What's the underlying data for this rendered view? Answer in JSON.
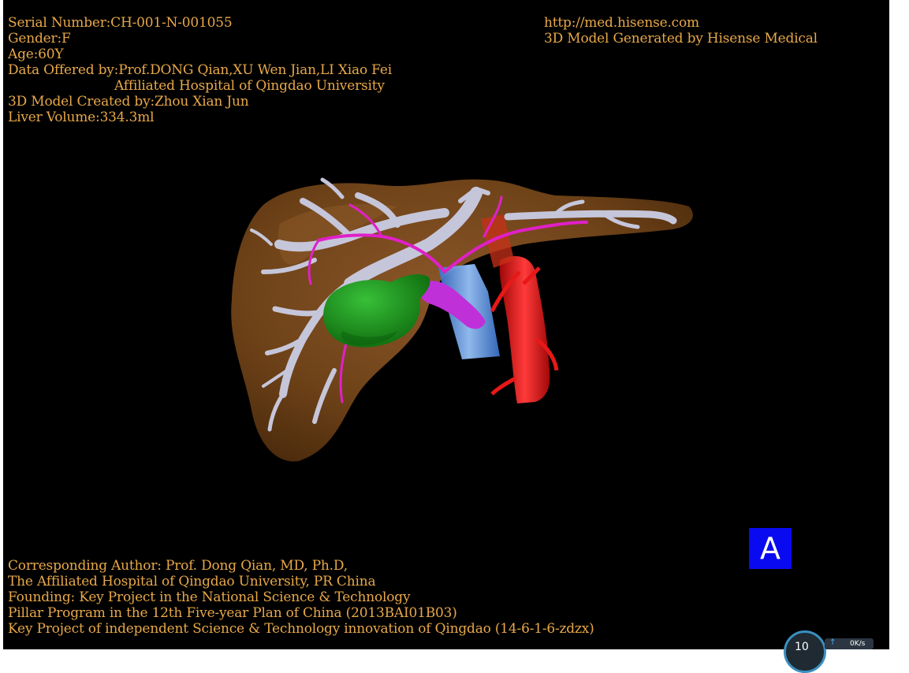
{
  "header_left": {
    "serial": "Serial Number:CH-001-N-001055",
    "gender": "Gender:F",
    "age": "Age:60Y",
    "data_offered": "Data Offered by:Prof.DONG Qian,XU Wen Jian,LI Xiao Fei",
    "hospital": "Affiliated Hospital of Qingdao University",
    "model_created": "3D Model Created by:Zhou Xian Jun",
    "liver_volume": "Liver Volume:334.3ml"
  },
  "header_right": {
    "url": "http://med.hisense.com",
    "generated_by": "3D Model Generated by Hisense Medical"
  },
  "footer": {
    "line1": "Corresponding Author: Prof. Dong Qian, MD, Ph.D,",
    "line2": "The Affiliated Hospital of Qingdao University, PR China",
    "line3": "Founding: Key Project in the National Science & Technology",
    "line4": "Pillar Program in the 12th Five-year Plan of China (2013BAI01B03)",
    "line5": "Key Project of independent Science & Technology innovation of Qingdao (14-6-1-6-zdzx)"
  },
  "view_label": "A",
  "net_widget": {
    "number": "10",
    "speed": "0K/s"
  },
  "colors": {
    "text": "#e8a848",
    "liver": "#7a4a1c",
    "portal_vein": "#c8c8dc",
    "hepatic_artery": "#e020c8",
    "tumor": "#1e9a1e",
    "ivc": "#6aa8f0",
    "aorta": "#e81818",
    "view_label_bg": "#0a0af0"
  }
}
